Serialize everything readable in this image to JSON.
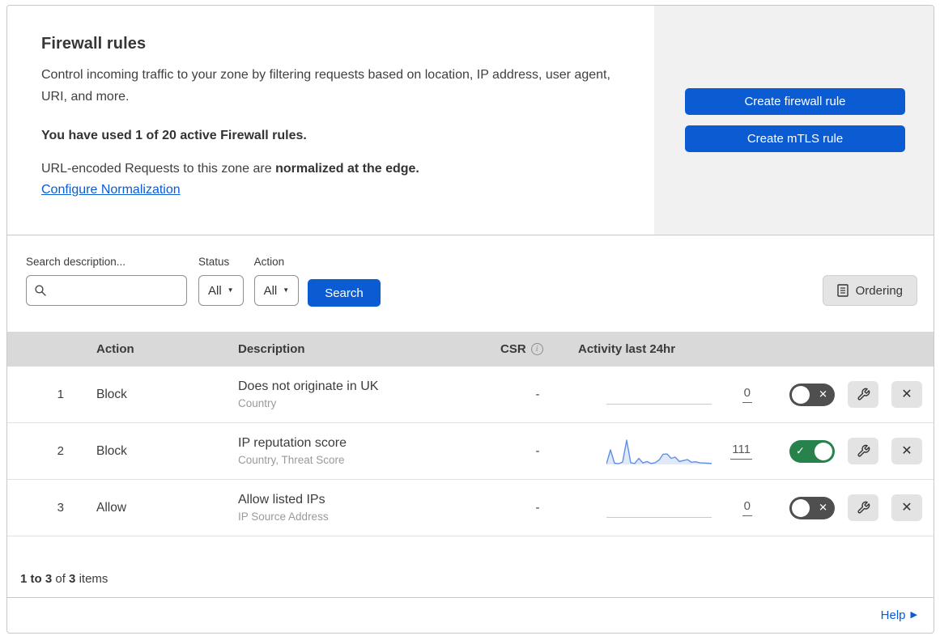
{
  "header": {
    "title": "Firewall rules",
    "description": "Control incoming traffic to your zone by filtering requests based on location, IP address, user agent, URI, and more.",
    "usage": "You have used 1 of 20 active Firewall rules.",
    "normalization_prefix": "URL-encoded Requests to this zone are ",
    "normalization_bold": "normalized at the edge.",
    "normalization_link": "Configure Normalization",
    "create_firewall_button": "Create firewall rule",
    "create_mtls_button": "Create mTLS rule"
  },
  "filters": {
    "search_label": "Search description...",
    "status_label": "Status",
    "status_value": "All",
    "action_label": "Action",
    "action_value": "All",
    "search_button": "Search",
    "ordering_button": "Ordering"
  },
  "table": {
    "columns": {
      "action": "Action",
      "description": "Description",
      "csr": "CSR",
      "csr_info": "i",
      "activity": "Activity last 24hr"
    },
    "rows": [
      {
        "num": "1",
        "action": "Block",
        "description": "Does not originate in UK",
        "fields": "Country",
        "csr": "-",
        "activity_count": "0",
        "enabled": false
      },
      {
        "num": "2",
        "action": "Block",
        "description": "IP reputation score",
        "fields": "Country, Threat Score",
        "csr": "-",
        "activity_count": "111",
        "enabled": true,
        "sparkline": [
          2,
          60,
          5,
          3,
          10,
          100,
          7,
          4,
          25,
          6,
          12,
          4,
          7,
          18,
          42,
          43,
          25,
          30,
          12,
          16,
          20,
          9,
          11,
          7,
          6,
          5,
          4
        ]
      },
      {
        "num": "3",
        "action": "Allow",
        "description": "Allow listed IPs",
        "fields": "IP Source Address",
        "csr": "-",
        "activity_count": "0",
        "enabled": false
      }
    ]
  },
  "footer": {
    "items_range": "1 to 3",
    "items_of": "of",
    "items_total": "3",
    "items_suffix": "items",
    "help": "Help"
  },
  "colors": {
    "accent_blue": "#0b5bd3",
    "toggle_on_green": "#27824c",
    "toggle_off_gray": "#4f4f4f",
    "sparkline_stroke": "#5f8fe8",
    "sparkline_fill": "#dfe9f9",
    "table_header_bg": "#d9d9d9",
    "panel_gray": "#f1f1f1"
  }
}
